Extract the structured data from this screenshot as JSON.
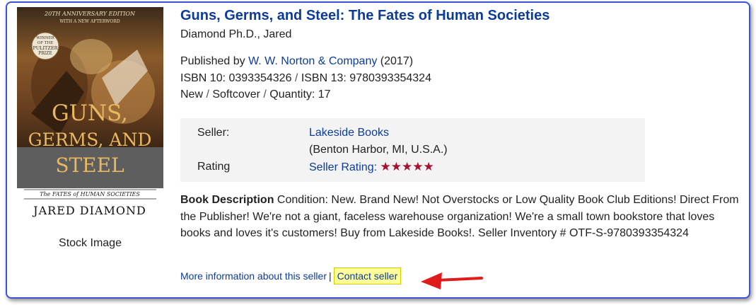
{
  "listing": {
    "title": "Guns, Germs, and Steel: The Fates of Human Societies",
    "author": "Diamond Ph.D., Jared",
    "published_by_prefix": "Published by ",
    "publisher": "W. W. Norton & Company",
    "year": " (2017)",
    "isbn10": "ISBN 10: 0393354326",
    "isbn_sep": " / ",
    "isbn13": "ISBN 13: 9780393354324",
    "condition": "New",
    "binding": "Softcover",
    "quantity": "Quantity: 17",
    "cond_sep": " / "
  },
  "cover": {
    "edition_line1": "20TH ANNIVERSARY EDITION",
    "edition_line2": "WITH A NEW AFTERWORD",
    "badge_line1": "WINNER",
    "badge_line2": "OF THE",
    "badge_line3": "PULITZER",
    "badge_line4": "PRIZE",
    "title_line1": "GUNS,",
    "title_line2": "GERMS, AND",
    "title_line3": "STEEL",
    "subtitle": "The FATES of HUMAN SOCIETIES",
    "author": "JARED DIAMOND",
    "stock_label": "Stock Image"
  },
  "seller": {
    "seller_label": "Seller:",
    "name": "Lakeside Books",
    "location": "(Benton Harbor, MI, U.S.A.)",
    "rating_label": "Rating",
    "rating_link": "Seller Rating:",
    "stars": "★★★★★",
    "rating_value": 5,
    "star_color": "#a5112e"
  },
  "description": {
    "heading": "Book Description",
    "text": " Condition: New. Brand New! Not Overstocks or Low Quality Book Club Editions! Direct From the Publisher! We're not a giant, faceless warehouse organization! We're a small town bookstore that loves books and loves it's customers! Buy from Lakeside Books!. Seller Inventory # OTF-S-9780393354324"
  },
  "footer": {
    "more_info": "More information about this seller",
    "divider": "|",
    "contact": "Contact seller"
  },
  "colors": {
    "link": "#0d3b9a",
    "border": "#3b55d6",
    "highlight": "#ffff99",
    "arrow": "#e01b1b"
  }
}
